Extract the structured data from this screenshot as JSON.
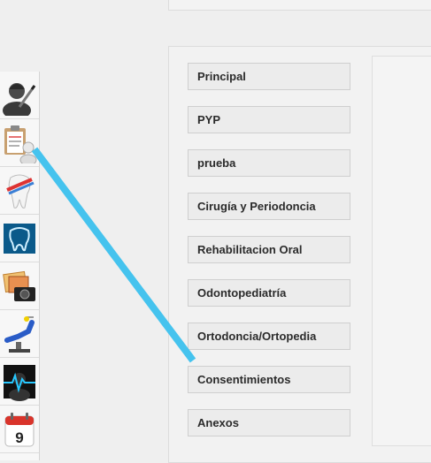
{
  "menu": {
    "items": [
      {
        "label": "Principal"
      },
      {
        "label": "PYP"
      },
      {
        "label": "prueba"
      },
      {
        "label": "Cirugía y Periodoncia"
      },
      {
        "label": "Rehabilitacion Oral"
      },
      {
        "label": "Odontopediatría"
      },
      {
        "label": "Ortodoncia/Ortopedia"
      },
      {
        "label": "Consentimientos"
      },
      {
        "label": "Anexos"
      }
    ]
  },
  "toolbar": {
    "tools": [
      {
        "icon": "doctor-pen-icon"
      },
      {
        "icon": "clipboard-patient-icon"
      },
      {
        "icon": "tooth-brush-icon"
      },
      {
        "icon": "tooth-xray-icon"
      },
      {
        "icon": "photo-camera-icon"
      },
      {
        "icon": "dental-chair-icon"
      },
      {
        "icon": "patient-monitor-icon"
      },
      {
        "icon": "calendar-icon",
        "day": "9"
      }
    ]
  },
  "colors": {
    "connector": "#45c3ee",
    "button_bg": "#ececec",
    "button_text": "#2b2b2b"
  }
}
